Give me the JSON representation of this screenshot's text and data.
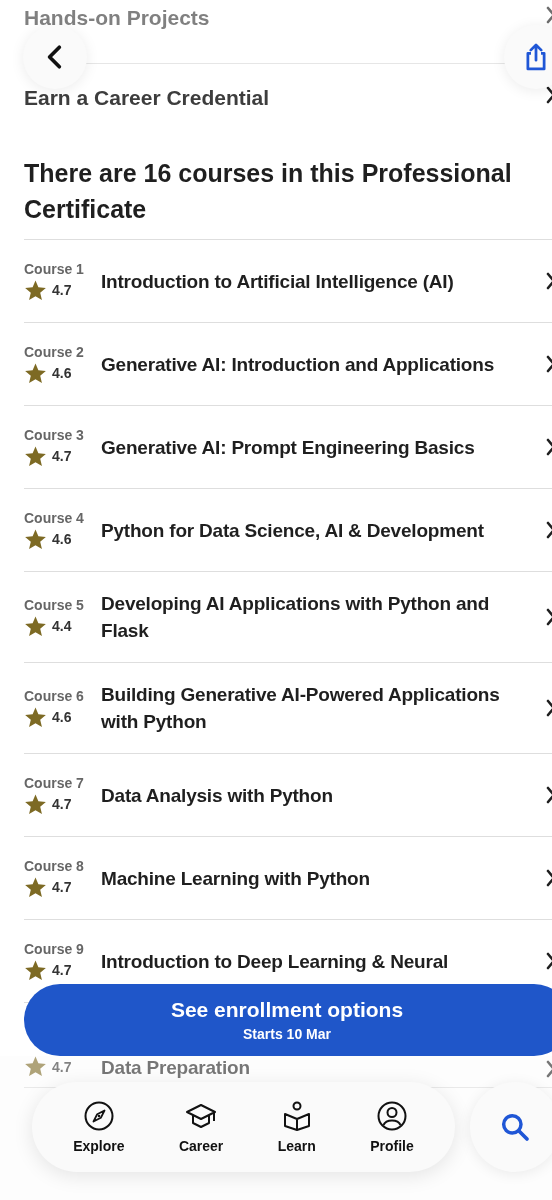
{
  "sections": [
    {
      "label": "Hands-on Projects"
    },
    {
      "label": "Earn a Career Credential"
    }
  ],
  "heading": "There are 16 courses in this Professional Certificate",
  "courses": [
    {
      "label": "Course 1",
      "rating": "4.7",
      "title": "Introduction to Artificial Intelligence (AI)"
    },
    {
      "label": "Course 2",
      "rating": "4.6",
      "title": "Generative AI: Introduction and Applications"
    },
    {
      "label": "Course 3",
      "rating": "4.7",
      "title": "Generative AI: Prompt Engineering Basics"
    },
    {
      "label": "Course 4",
      "rating": "4.6",
      "title": "Python for Data Science, AI & Development"
    },
    {
      "label": "Course 5",
      "rating": "4.4",
      "title": "Developing AI Applications with Python and Flask"
    },
    {
      "label": "Course 6",
      "rating": "4.6",
      "title": "Building Generative AI-Powered Applications with Python"
    },
    {
      "label": "Course 7",
      "rating": "4.7",
      "title": "Data Analysis with Python"
    },
    {
      "label": "Course 8",
      "rating": "4.7",
      "title": "Machine Learning with Python"
    },
    {
      "label": "Course 9",
      "rating": "4.7",
      "title": "Introduction to Deep Learning & Neural"
    },
    {
      "rating": "4.7",
      "title": "Data Preparation"
    }
  ],
  "enroll": {
    "label": "See enrollment options",
    "sublabel": "Starts 10 Mar"
  },
  "nav": [
    {
      "label": "Explore"
    },
    {
      "label": "Career"
    },
    {
      "label": "Learn"
    },
    {
      "label": "Profile"
    }
  ]
}
